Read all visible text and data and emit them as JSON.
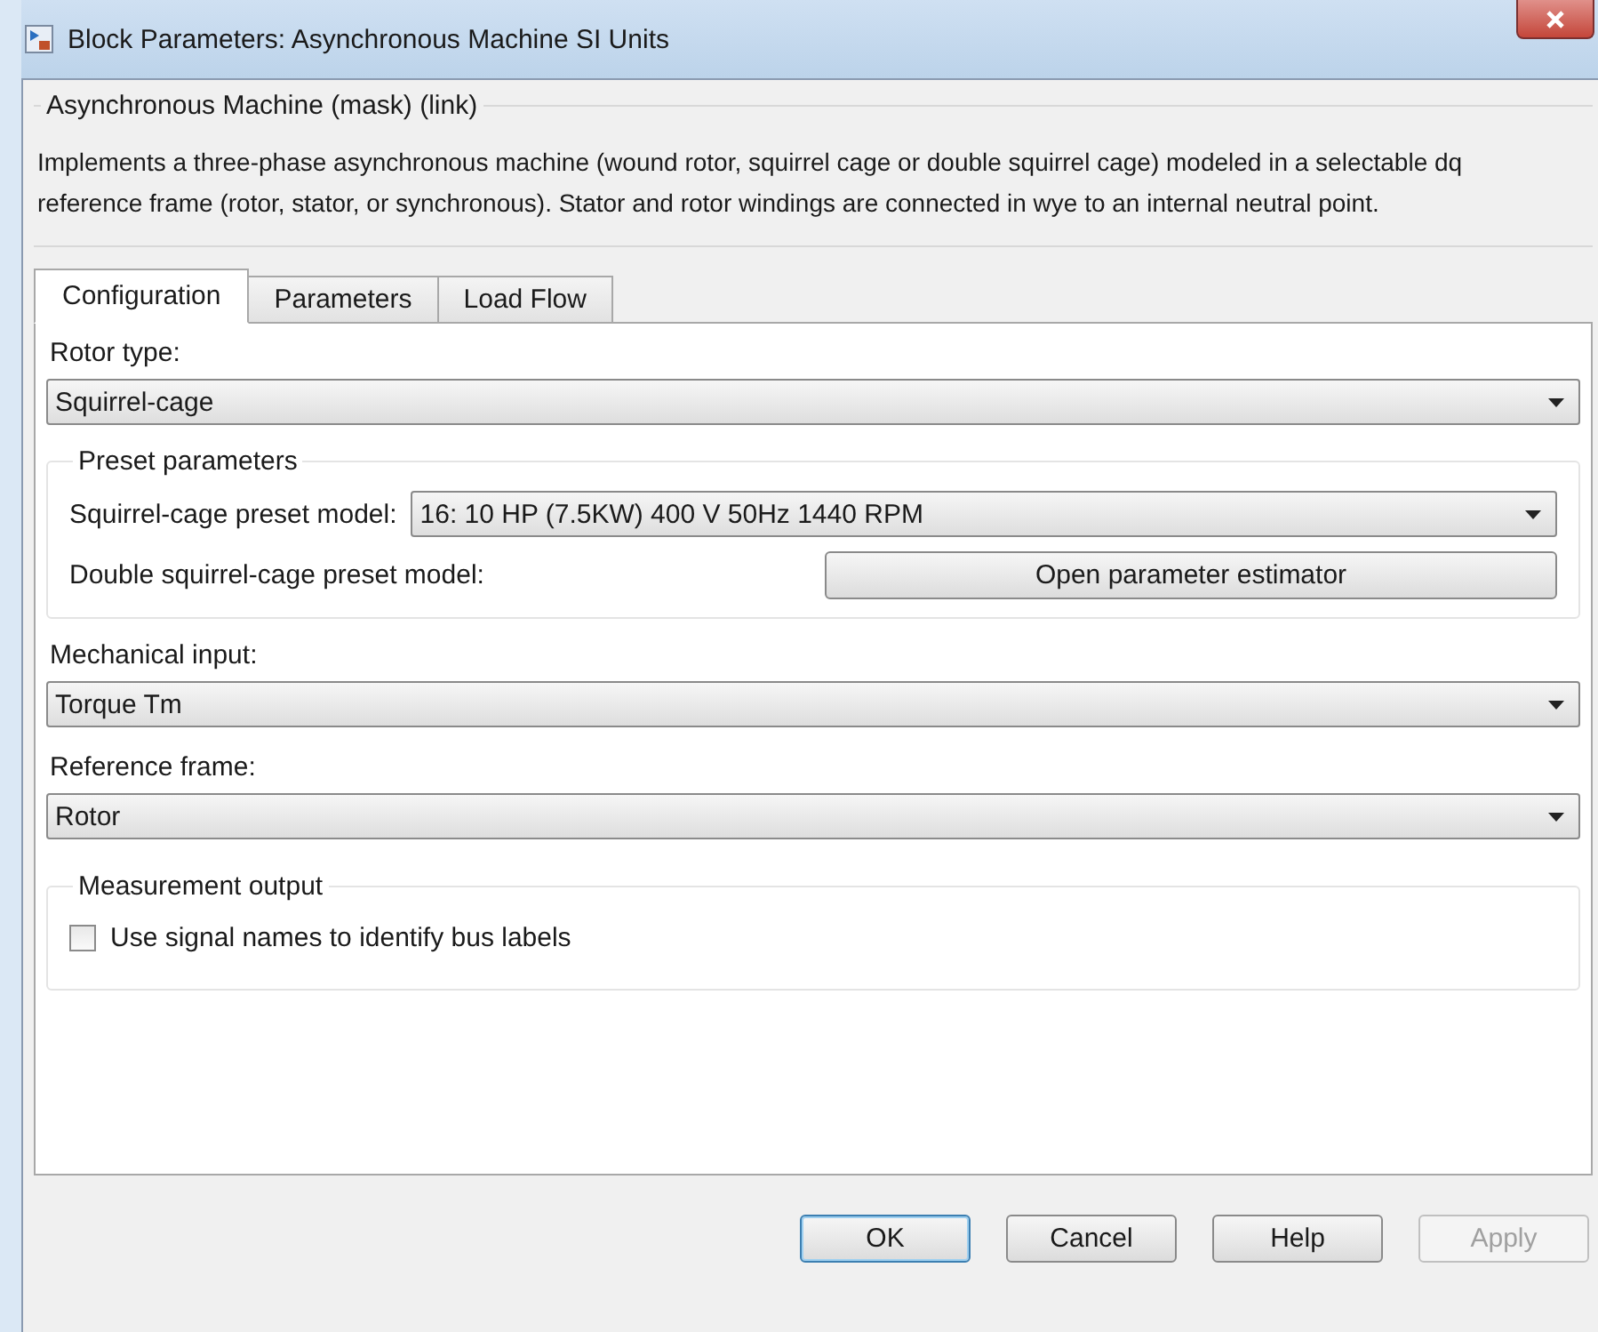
{
  "window": {
    "title": "Block Parameters: Asynchronous Machine SI Units"
  },
  "mask": {
    "title": "Asynchronous Machine (mask) (link)",
    "description": "Implements a three-phase asynchronous machine (wound rotor, squirrel cage or double squirrel cage) modeled in a selectable dq reference frame (rotor, stator, or synchronous). Stator and rotor windings are connected in wye to an internal neutral point."
  },
  "tabs": [
    {
      "label": "Configuration",
      "selected": true
    },
    {
      "label": "Parameters",
      "selected": false
    },
    {
      "label": "Load Flow",
      "selected": false
    }
  ],
  "rotor_type": {
    "label": "Rotor type:",
    "value": "Squirrel-cage"
  },
  "preset_parameters": {
    "title": "Preset parameters",
    "squirrel_cage_label": "Squirrel-cage preset model:",
    "squirrel_cage_value": "16:  10 HP (7.5KW)  400 V 50Hz 1440 RPM",
    "double_cage_label": "Double squirrel-cage preset model:",
    "estimator_button": "Open parameter estimator"
  },
  "mechanical_input": {
    "label": "Mechanical input:",
    "value": "Torque Tm"
  },
  "reference_frame": {
    "label": "Reference frame:",
    "value": "Rotor"
  },
  "measurement_output": {
    "title": "Measurement output",
    "checkbox": {
      "label": "Use signal names to identify bus labels",
      "checked": false
    }
  },
  "buttons": [
    {
      "label": "OK",
      "default": true,
      "disabled": false
    },
    {
      "label": "Cancel",
      "default": false,
      "disabled": false
    },
    {
      "label": "Help",
      "default": false,
      "disabled": false
    },
    {
      "label": "Apply",
      "default": false,
      "disabled": true
    }
  ]
}
